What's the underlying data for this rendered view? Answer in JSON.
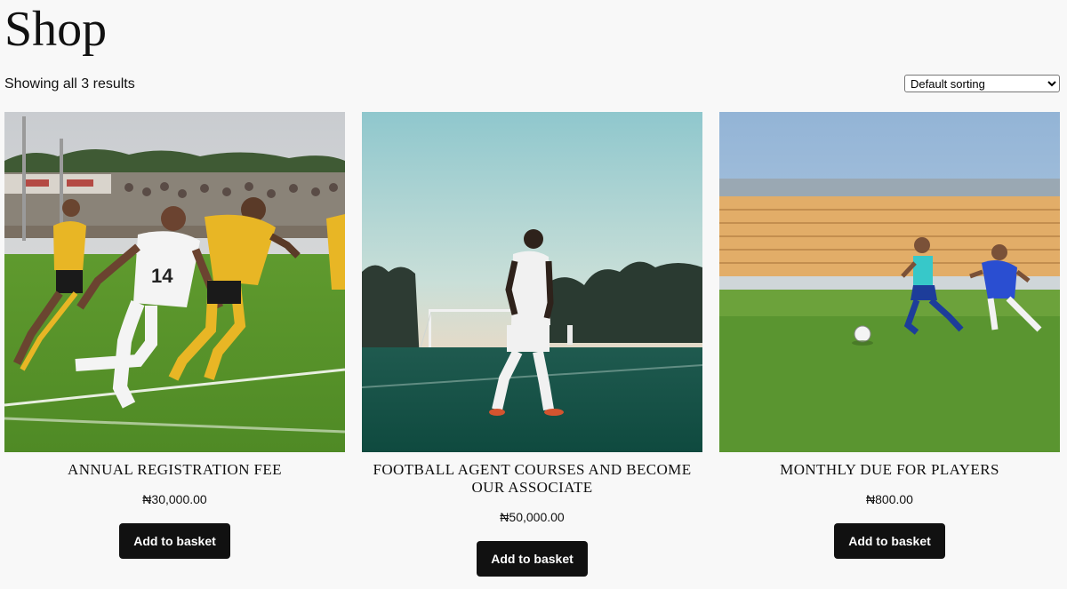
{
  "page": {
    "title": "Shop",
    "result_count": "Showing all 3 results"
  },
  "sorting": {
    "selected": "Default sorting"
  },
  "products": [
    {
      "title": "ANNUAL REGISTRATION FEE",
      "price": "₦30,000.00",
      "button_label": "Add to basket",
      "image_description": "soccer match, player in white number 14 against players in yellow"
    },
    {
      "title": "FOOTBALL AGENT COURSES AND BECOME OUR ASSOCIATE",
      "price": "₦50,000.00",
      "button_label": "Add to basket",
      "image_description": "player in white kit walking on a pitch at dusk"
    },
    {
      "title": "MONTHLY DUE FOR PLAYERS",
      "price": "₦800.00",
      "button_label": "Add to basket",
      "image_description": "two boys chasing a ball in front of empty stands"
    }
  ],
  "colors": {
    "background": "#f8f8f8",
    "button_background": "#111111",
    "button_text": "#ffffff"
  }
}
